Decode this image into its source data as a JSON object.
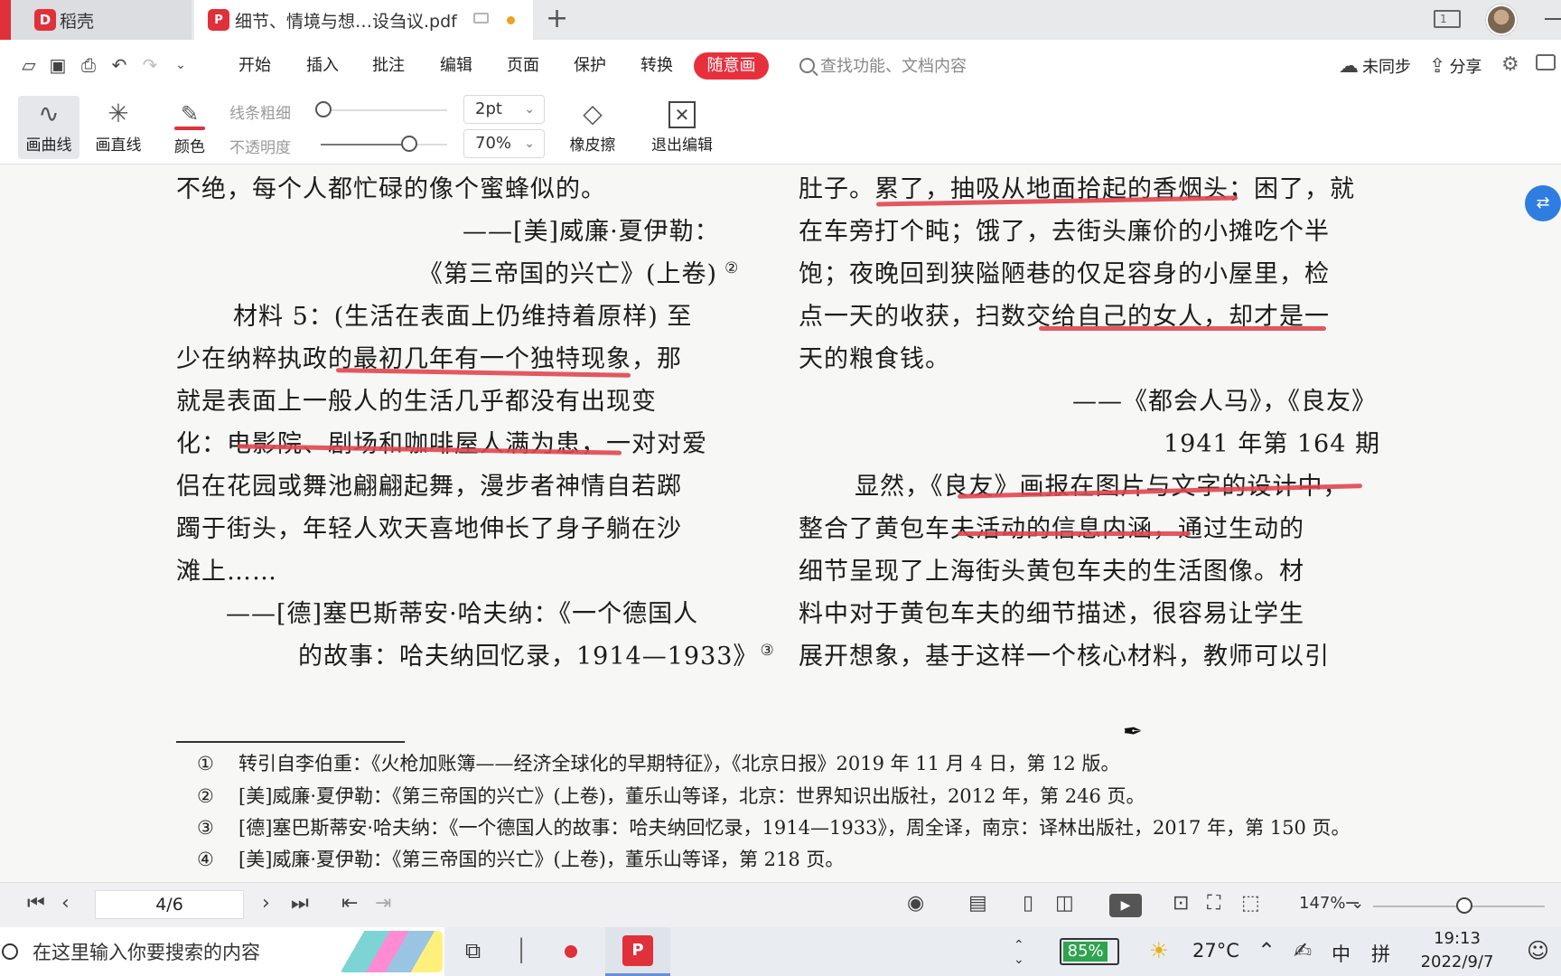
{
  "tabs": {
    "app": {
      "logo": "D",
      "label": "稻壳"
    },
    "doc": {
      "logo": "P",
      "label": "细节、情境与想…设刍议.pdf"
    },
    "add": "+"
  },
  "window": {
    "layout_badge": "1"
  },
  "menu": {
    "items": [
      "开始",
      "插入",
      "批注",
      "编辑",
      "页面",
      "保护",
      "转换"
    ],
    "active": "随意画",
    "search_placeholder": "查找功能、文档内容",
    "sync": "未同步",
    "share": "分享"
  },
  "ribbon": {
    "curve": "画曲线",
    "line": "画直线",
    "color": "颜色",
    "line_width_label": "线条粗细",
    "opacity_label": "不透明度",
    "line_width": "2pt",
    "opacity": "70%",
    "line_width_level": 0.0,
    "opacity_level": 0.7,
    "eraser": "橡皮擦",
    "exit": "退出编辑"
  },
  "document": {
    "left": [
      "不绝，每个人都忙碌的像个蜜蜂似的。",
      "——[美]威廉·夏伊勒：",
      "《第三帝国的兴亡》(上卷)",
      "材料 5：(生活在表面上仍维持着原样) 至",
      "少在纳粹执政的最初几年有一个独特现象，那",
      "就是表面上一般人的生活几乎都没有出现变",
      "化：电影院、剧场和咖啡屋人满为患，一对对爱",
      "侣在花园或舞池翩翩起舞，漫步者神情自若踯",
      "躅于街头，年轻人欢天喜地伸长了身子躺在沙",
      "滩上……",
      "——[德]塞巴斯蒂安·哈夫纳：《一个德国人",
      "的故事：哈夫纳回忆录，1914—1933》"
    ],
    "left_sup_2": "②",
    "left_sup_3": "③",
    "right": [
      "肚子。累了，抽吸从地面拾起的香烟头；困了，就",
      "在车旁打个盹；饿了，去街头廉价的小摊吃个半",
      "饱；夜晚回到狭隘陋巷的仅足容身的小屋里，检",
      "点一天的收获，扫数交给自己的女人，却才是一",
      "天的粮食钱。",
      "——《都会人马》，《良友》",
      "1941 年第 164 期",
      "显然，《良友》画报在图片与文字的设计中，",
      "整合了黄包车夫活动的信息内涵，通过生动的",
      "细节呈现了上海街头黄包车夫的生活图像。材",
      "料中对于黄包车夫的细节描述，很容易让学生",
      "展开想象，基于这样一个核心材料，教师可以引"
    ],
    "footnotes": [
      {
        "num": "①",
        "text": "转引自李伯重：《火枪加账簿——经济全球化的早期特征》，《北京日报》2019 年 11 月 4 日，第 12 版。"
      },
      {
        "num": "②",
        "text": "[美]威廉·夏伊勒：《第三帝国的兴亡》(上卷)，董乐山等译，北京：世界知识出版社，2012 年，第 246 页。"
      },
      {
        "num": "③",
        "text": "[德]塞巴斯蒂安·哈夫纳：《一个德国人的故事：哈夫纳回忆录，1914—1933》，周全译，南京：译林出版社，2017 年，第 150 页。"
      },
      {
        "num": "④",
        "text": "[美]威廉·夏伊勒：《第三帝国的兴亡》(上卷)，董乐山等译，第 218 页。"
      }
    ]
  },
  "status": {
    "page": "4/6",
    "zoom": "147%",
    "zoom_level": 0.53
  },
  "taskbar": {
    "search_placeholder": "在这里输入你要搜索的内容",
    "battery": "85%",
    "temperature": "27°C",
    "ime_lang": "中",
    "ime_mode": "拼",
    "time": "19:13",
    "date": "2022/9/7"
  },
  "colors": {
    "accent": "#e0303a",
    "ink": "#e0454f",
    "fab": "#2f7de1"
  }
}
